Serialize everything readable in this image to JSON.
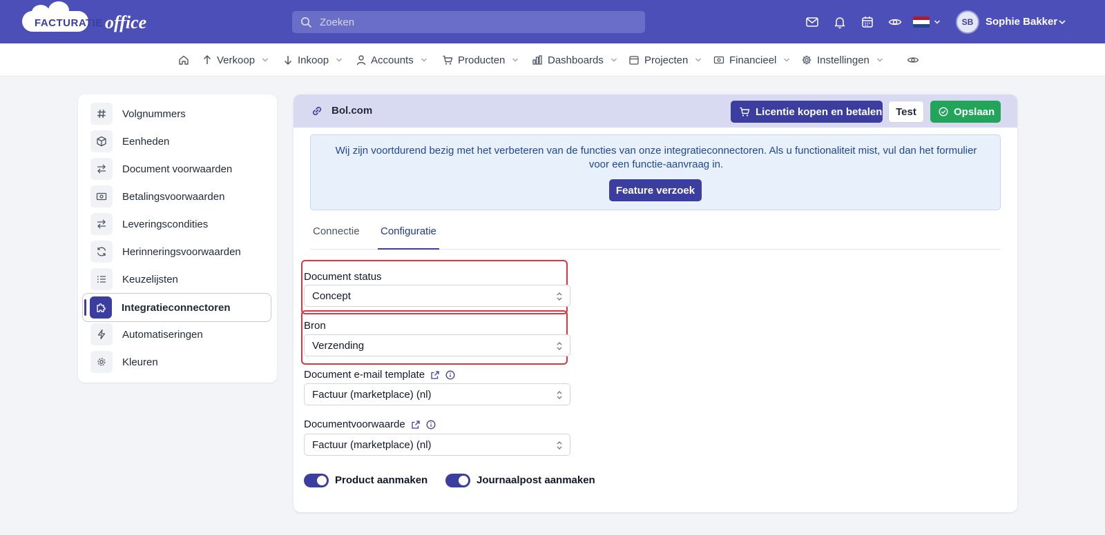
{
  "header": {
    "logo_word1": "FACTURATIE",
    "logo_word2": "office",
    "search_placeholder": "Zoeken",
    "user_initials": "SB",
    "user_name": "Sophie Bakker",
    "flag_colors": [
      "#ae1c28",
      "#ffffff",
      "#21468b"
    ]
  },
  "nav": {
    "items": [
      {
        "label": "Verkoop",
        "icon": "arrow-up-icon"
      },
      {
        "label": "Inkoop",
        "icon": "arrow-down-icon"
      },
      {
        "label": "Accounts",
        "icon": "user-icon"
      },
      {
        "label": "Producten",
        "icon": "cart-icon"
      },
      {
        "label": "Dashboards",
        "icon": "bar-chart-icon"
      },
      {
        "label": "Projecten",
        "icon": "calendar-icon"
      },
      {
        "label": "Financieel",
        "icon": "money-icon"
      },
      {
        "label": "Instellingen",
        "icon": "gear-icon"
      }
    ]
  },
  "sidebar": {
    "items": [
      {
        "label": "Volgnummers",
        "icon": "hash-icon"
      },
      {
        "label": "Eenheden",
        "icon": "box-icon"
      },
      {
        "label": "Document voorwaarden",
        "icon": "swap-icon"
      },
      {
        "label": "Betalingsvoorwaarden",
        "icon": "cash-icon"
      },
      {
        "label": "Leveringscondities",
        "icon": "swap-icon"
      },
      {
        "label": "Herinneringsvoorwaarden",
        "icon": "refresh-icon"
      },
      {
        "label": "Keuzelijsten",
        "icon": "list-icon"
      },
      {
        "label": "Integratieconnectoren",
        "icon": "puzzle-icon"
      },
      {
        "label": "Automatiseringen",
        "icon": "bolt-icon"
      },
      {
        "label": "Kleuren",
        "icon": "gear-icon"
      }
    ],
    "active_index": 7
  },
  "panel": {
    "title": "Bol.com",
    "license_button": "Licentie kopen en betalen",
    "test_button": "Test",
    "save_button": "Opslaan",
    "notice_text": "Wij zijn voortdurend bezig met het verbeteren van de functies van onze integratieconnectoren. Als u functionaliteit mist, vul dan het formulier voor een functie-aanvraag in.",
    "feature_button": "Feature verzoek",
    "tabs": [
      "Connectie",
      "Configuratie"
    ],
    "active_tab": 1,
    "fields": {
      "document_status": {
        "label": "Document status",
        "value": "Concept"
      },
      "bron": {
        "label": "Bron",
        "value": "Verzending"
      },
      "email_template": {
        "label": "Document e-mail template",
        "value": "Factuur (marketplace) (nl)"
      },
      "documentvoorwaarde": {
        "label": "Documentvoorwaarde",
        "value": "Factuur (marketplace) (nl)"
      }
    },
    "toggles": {
      "product": {
        "label": "Product aanmaken",
        "on": true
      },
      "journaalpost": {
        "label": "Journaalpost aanmaken",
        "on": true
      }
    }
  },
  "colors": {
    "brand": "#4c4fb8",
    "primary": "#3b3e9e",
    "success": "#22a55a",
    "highlight": "#e0323f"
  }
}
